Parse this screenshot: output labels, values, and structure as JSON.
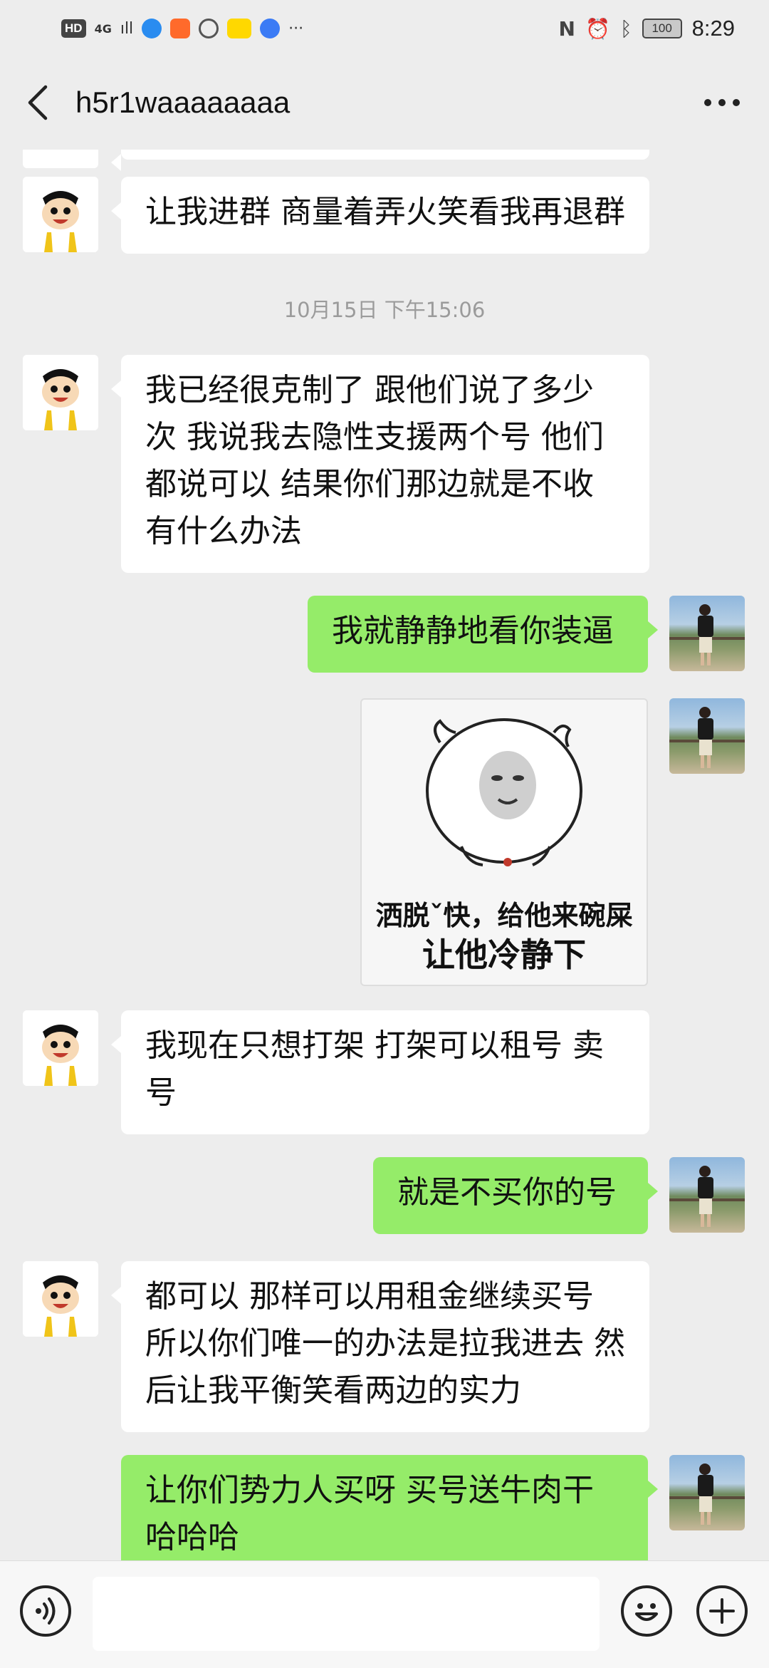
{
  "status_bar": {
    "hd": "HD",
    "network": "4G",
    "signal": "ıll",
    "more": "···",
    "battery": "100",
    "time": "8:29",
    "icons": [
      "nfc-icon",
      "alarm-icon",
      "bluetooth-icon"
    ]
  },
  "header": {
    "title": "h5r1waaaaaaaa"
  },
  "messages": [
    {
      "side": "left",
      "text": "让我进群 商量着弄火笑看我再退群"
    },
    {
      "type": "time",
      "text": "10月15日 下午15:06"
    },
    {
      "side": "left",
      "lines": [
        "我已经很克制了 跟他们说了多少",
        "次 我说我去隐性支援两个号 他们",
        "都说可以 结果你们那边就是不收",
        "有什么办法"
      ]
    },
    {
      "side": "right",
      "text": "我就静静地看你装逼"
    },
    {
      "side": "right",
      "type": "sticker",
      "caption_1": "洒脱ˇ快，给他来碗屎",
      "caption_2": "让他冷静下"
    },
    {
      "side": "left",
      "lines": [
        "我现在只想打架  打架可以租号 卖",
        "号"
      ]
    },
    {
      "side": "right",
      "text": "就是不买你的号"
    },
    {
      "side": "left",
      "lines": [
        "都可以 那样可以用租金继续买号",
        "所以你们唯一的办法是拉我进去 然",
        "后让我平衡笑看两边的实力"
      ]
    },
    {
      "side": "right",
      "lines": [
        "让你们势力人买呀  买号送牛肉干",
        "哈哈哈"
      ]
    }
  ],
  "colors": {
    "bubble_me": "#95ec69",
    "bubble_other": "#ffffff",
    "background": "#ededed"
  }
}
